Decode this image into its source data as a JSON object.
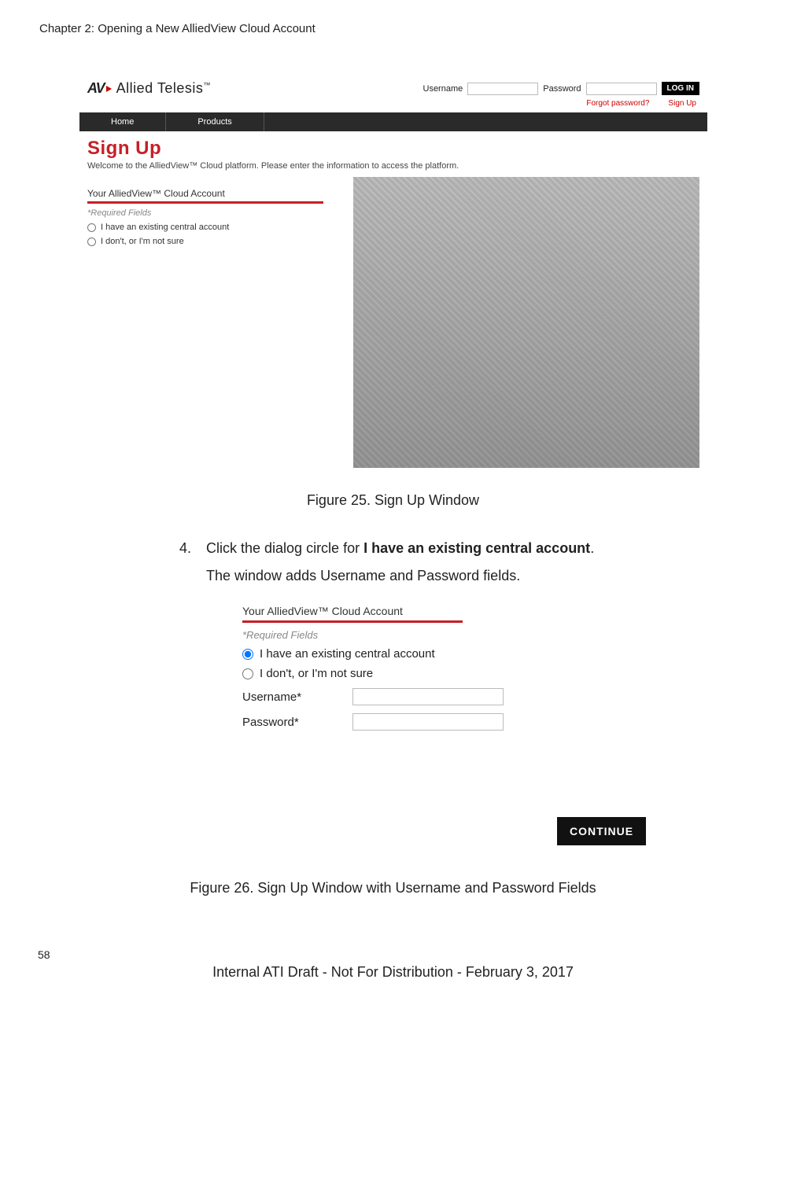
{
  "chapter": "Chapter 2: Opening a New AlliedView Cloud Account",
  "screenshot1": {
    "logo_av": "AV",
    "logo_brand": "Allied Telesis",
    "username_label": "Username",
    "password_label": "Password",
    "login": "LOG IN",
    "forgot": "Forgot password?",
    "signup_link": "Sign Up",
    "nav_home": "Home",
    "nav_products": "Products",
    "h_signup": "Sign Up",
    "welcome": "Welcome to the AlliedView™ Cloud platform. Please enter the information to access the platform.",
    "section": "Your AlliedView™ Cloud Account",
    "required": "*Required Fields",
    "radio1": "I have an existing central account",
    "radio2": "I don't, or I'm not sure"
  },
  "caption1": "Figure 25. Sign Up Window",
  "step4_num": "4.",
  "step4_pre": "Click the dialog circle for ",
  "step4_bold": "I have an existing central account",
  "step4_post": ".",
  "step4_line2": "The window adds Username and Password fields.",
  "screenshot2": {
    "section": "Your AlliedView™ Cloud Account",
    "required": "*Required Fields",
    "radio1": "I have an existing central account",
    "radio2": "I don't, or I'm not sure",
    "username_label": "Username*",
    "password_label": "Password*",
    "continue": "CONTINUE"
  },
  "caption2": "Figure 26. Sign Up Window with Username and Password Fields",
  "page_number": "58",
  "footer": "Internal ATI Draft - Not For Distribution - February 3, 2017"
}
